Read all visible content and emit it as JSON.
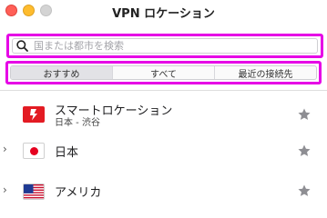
{
  "window": {
    "title": "VPN ロケーション"
  },
  "search": {
    "placeholder": "国または都市を検索",
    "value": ""
  },
  "tabs": [
    {
      "label": "おすすめ",
      "active": true
    },
    {
      "label": "すべて",
      "active": false
    },
    {
      "label": "最近の接続先",
      "active": false
    }
  ],
  "locations": [
    {
      "name": "スマートロケーション",
      "subtitle": "日本 - 渋谷",
      "icon": "smart-location-icon",
      "expandable": false,
      "favorite": false
    },
    {
      "name": "日本",
      "icon": "japan-flag-icon",
      "expandable": true,
      "favorite": false
    },
    {
      "name": "アメリカ",
      "icon": "usa-flag-icon",
      "expandable": true,
      "favorite": false
    }
  ],
  "colors": {
    "highlight": "#e600e6",
    "smart_red": "#e31b23",
    "star_gray": "#8e8e93"
  }
}
